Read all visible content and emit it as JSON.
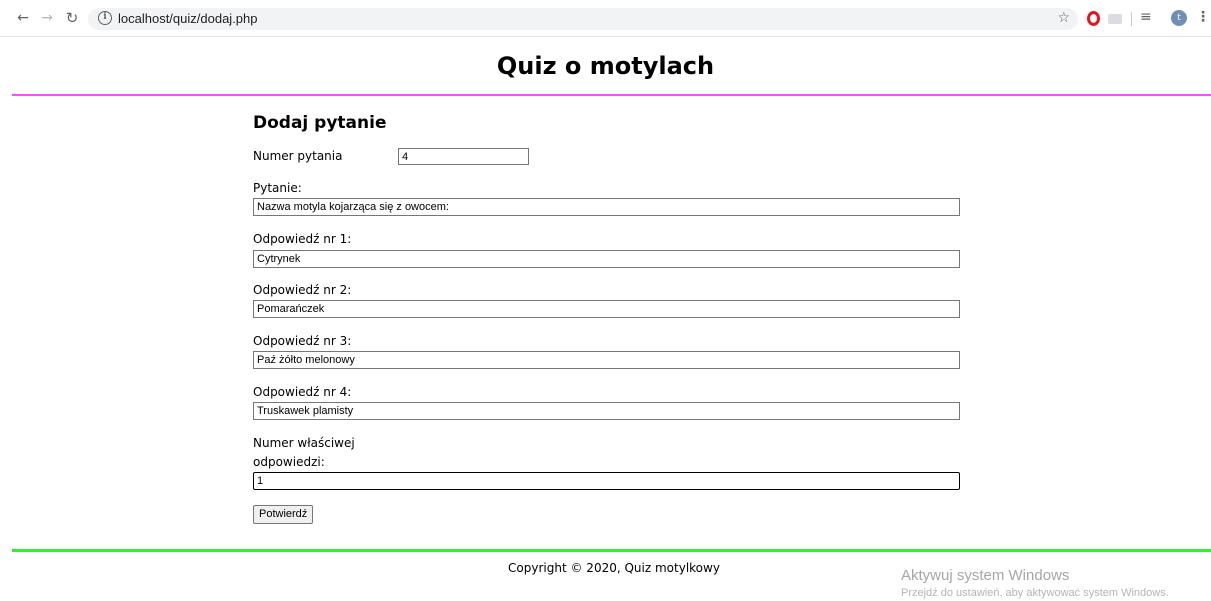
{
  "browser": {
    "url": "localhost/quiz/dodaj.php"
  },
  "page": {
    "title": "Quiz o motylach"
  },
  "form": {
    "heading": "Dodaj pytanie",
    "question_number_label": "Numer pytania",
    "question_number_value": "4",
    "question_label": "Pytanie:",
    "question_value": "Nazwa motyla kojarząca się z owocem:",
    "answers": [
      {
        "label": "Odpowiedź nr 1:",
        "value": "Cytrynek"
      },
      {
        "label": "Odpowiedź nr 2:",
        "value": "Pomarańczek"
      },
      {
        "label": "Odpowiedź nr 3:",
        "value": "Paź żółto melonowy"
      },
      {
        "label": "Odpowiedź nr 4:",
        "value": "Truskawek plamisty"
      }
    ],
    "correct_label_line1": "Numer właściwej",
    "correct_label_line2": "odpowiedzi:",
    "correct_value": "1",
    "submit_label": "Potwierdź"
  },
  "footer": {
    "copyright": "Copyright © 2020, Quiz motylkowy"
  },
  "overlay": {
    "activation_title": "Aktywuj system Windows",
    "activation_subtitle": "Przejdź do ustawień, aby aktywować system Windows."
  },
  "colors": {
    "header_line": "#ff4cff",
    "footer_line": "#33ee33"
  }
}
